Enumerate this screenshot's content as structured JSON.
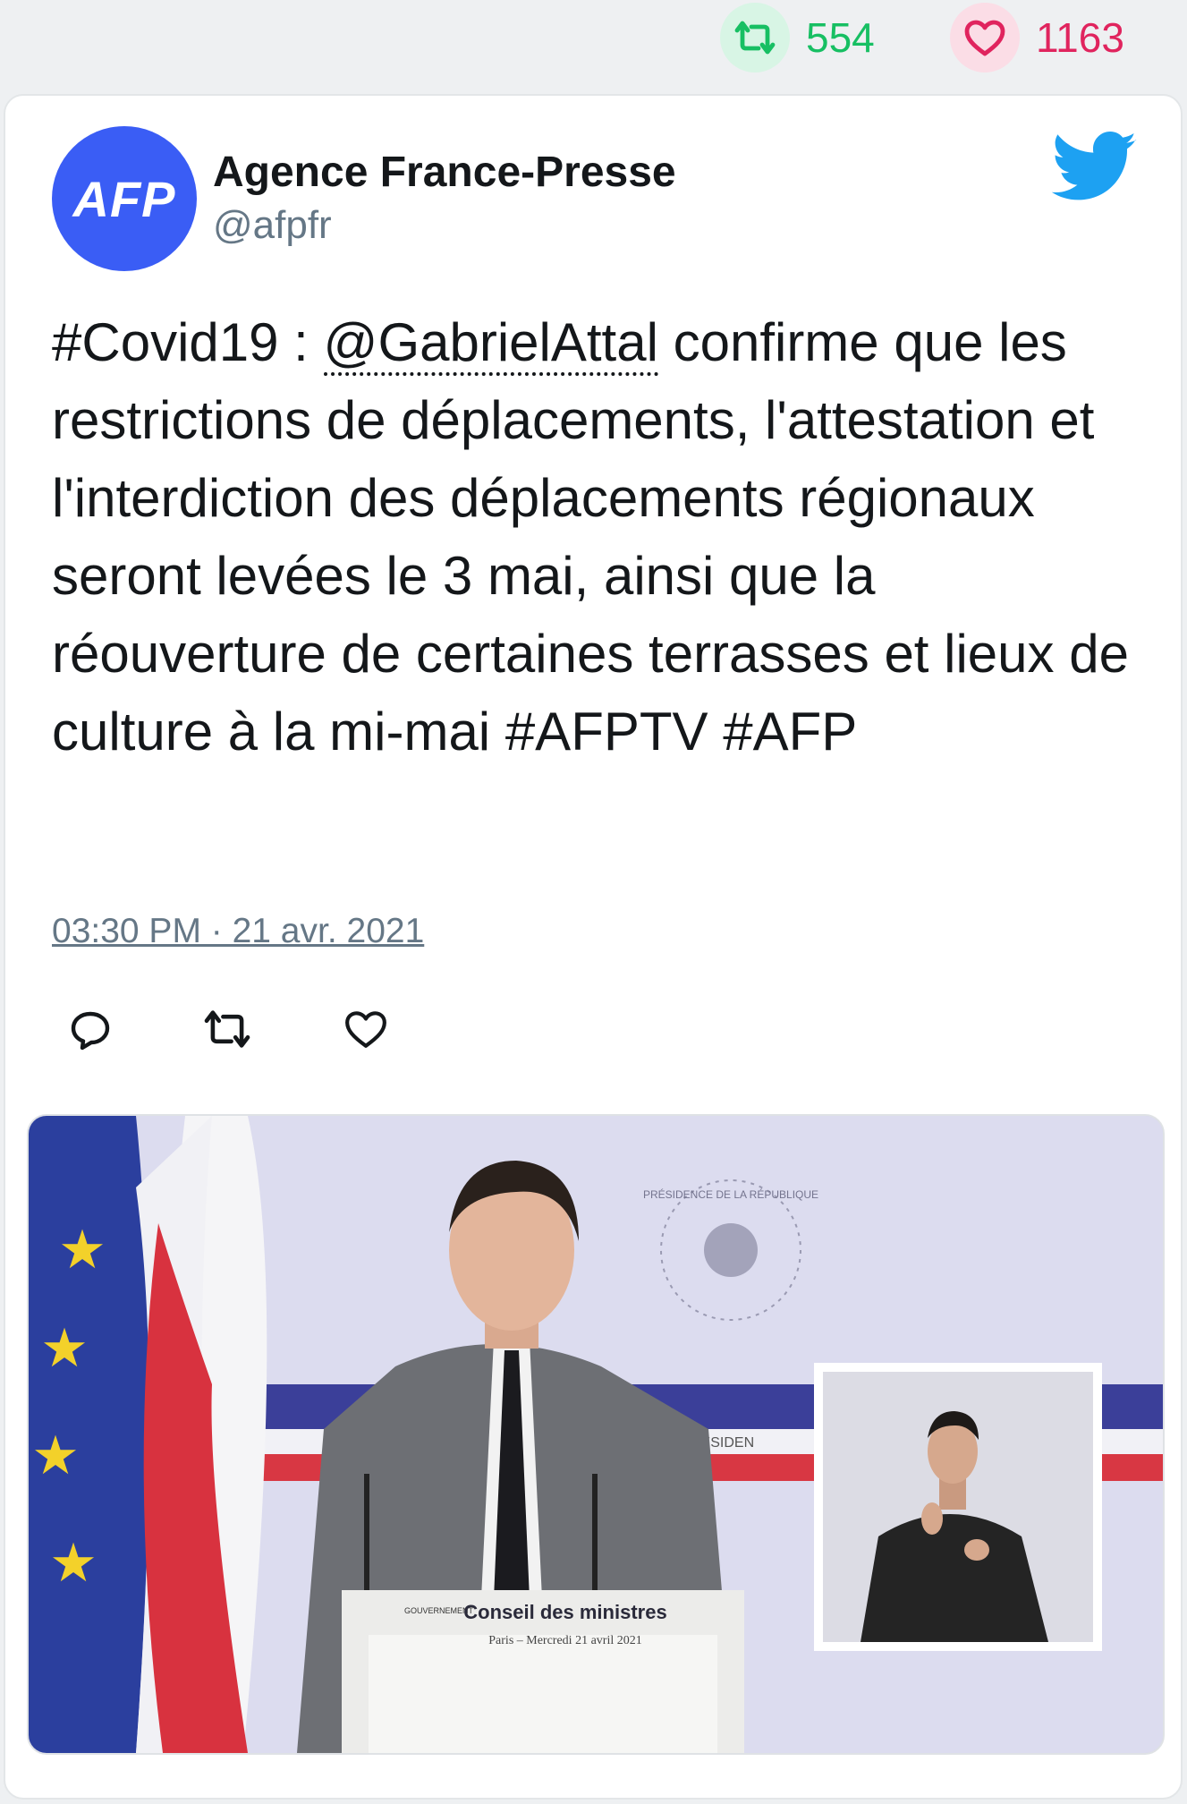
{
  "stats": {
    "retweets": "554",
    "likes": "1163"
  },
  "author": {
    "avatar_text": "AFP",
    "name": "Agence France-Presse",
    "handle": "@afpfr"
  },
  "tweet": {
    "hashtag_covid": "#Covid19",
    "separator": " : ",
    "mention": "@GabrielAttal",
    "body": " confirme que les restrictions de déplacements, l'attestation et l'interdiction des déplacements régionaux seront levées le 3 mai, ainsi que la réouverture de certaines terrasses et lieux de culture à la mi-mai ",
    "hashtag_afptv": "#AFPTV",
    "hashtag_afp": "#AFP",
    "timestamp": "03:30 PM · 21 avr. 2021"
  },
  "icons": {
    "retweet_stat": "retweet-icon",
    "like_stat": "heart-icon",
    "brand": "twitter-bird-icon",
    "reply_action": "reply-icon",
    "retweet_action": "retweet-icon",
    "like_action": "heart-icon"
  },
  "media": {
    "podium_label": "Conseil des ministres",
    "podium_sub": "Paris – Mercredi 21 avril 2021",
    "podium_gov": "GOUVERNEMENT",
    "seal_text": "PRÉSIDENCE DE LA RÉPUBLIQUE",
    "banner_text": "RÉSIDEN"
  },
  "colors": {
    "retweet": "#17bf63",
    "like": "#e0245e",
    "twitter_blue": "#1da1f2",
    "avatar_bg": "#3a5df5",
    "muted": "#657786"
  }
}
